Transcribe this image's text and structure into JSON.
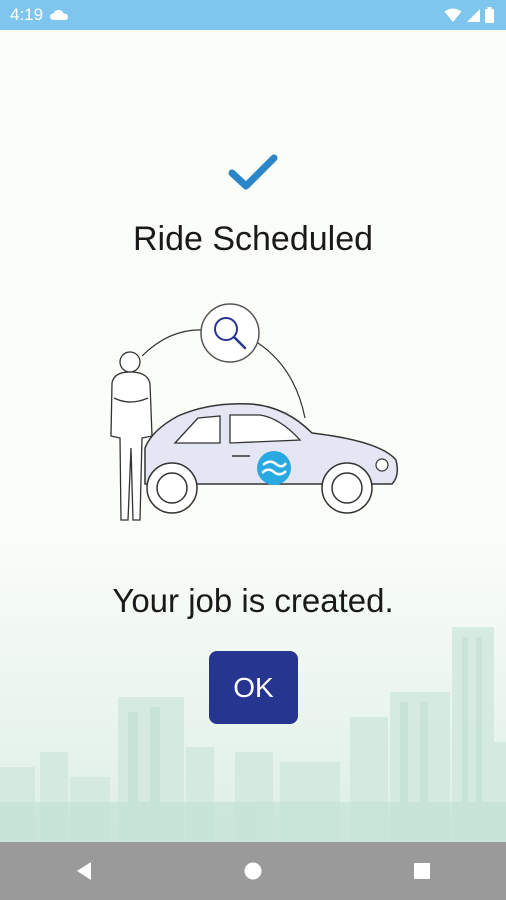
{
  "status_bar": {
    "time": "4:19",
    "icons": [
      "cloud-icon",
      "wifi-icon",
      "signal-icon",
      "battery-icon"
    ]
  },
  "confirmation": {
    "title": "Ride Scheduled",
    "message": "Your job is created.",
    "ok_label": "OK"
  },
  "colors": {
    "status_bar": "#7ec6ee",
    "check": "#2a86c8",
    "button": "#26358f",
    "nav_bar": "#9a9a9a",
    "car": "#e4e6f4",
    "logo": "#29a9e1"
  },
  "nav_bar": {
    "buttons": [
      "back-icon",
      "home-icon",
      "recents-icon"
    ]
  }
}
